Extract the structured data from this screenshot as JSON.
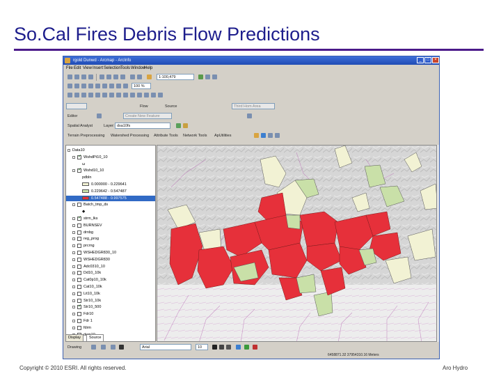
{
  "slide": {
    "title": "So.Cal Fires Debris Flow Predictions",
    "footer_left": "Copyright © 2010 ESRI. All rights reserved.",
    "footer_right": "Aro Hydro"
  },
  "window": {
    "title": "rgold Dunwd - Arcmap - ArcInfo",
    "menu": [
      "File",
      "Edit",
      "View",
      "Insert",
      "Selection",
      "Tools",
      "Window",
      "Help"
    ],
    "controls": [
      "_",
      "□",
      "×"
    ]
  },
  "toolbar": {
    "scale": "1:100,479",
    "zoom": "100 %",
    "flow": "Flow",
    "source": "Source",
    "target_label": "Third Hom Area",
    "editor": "Editor",
    "create_new_feature": "Create New Feature",
    "spatial_analyst": "Spatial Analyst",
    "layer_label": "Layer:",
    "layer_value": "dsa10fs",
    "menu_row": [
      "Terrain Preprocessing",
      "Watershed Processing",
      "Attribute Tools",
      "Network Tools",
      "ApUtilities"
    ],
    "font_name": "Arial",
    "font_size": "10",
    "drawing": "Drawing"
  },
  "toc": {
    "root": "Data10",
    "rows": [
      {
        "label": "Data10",
        "pm": true,
        "cb": "none",
        "indent": 0
      },
      {
        "label": "WshdPt10_10",
        "pm": true,
        "cb": "on",
        "indent": 1
      },
      {
        "label": "ω",
        "pm": false,
        "cb": "none",
        "indent": 2
      },
      {
        "label": "Wshd10_10",
        "pm": true,
        "cb": "on",
        "indent": 1
      },
      {
        "label": "pdbln",
        "pm": false,
        "cb": "none",
        "indent": 2
      },
      {
        "label": "0.000000 - 0.229641",
        "pm": false,
        "cb": "none",
        "indent": 2,
        "swatch": "#f2f2d4"
      },
      {
        "label": "0.229642 - 0.547487",
        "pm": false,
        "cb": "none",
        "indent": 2,
        "swatch": "#c9e0a8"
      },
      {
        "label": "0.547488 - 0.997575",
        "pm": false,
        "cb": "none",
        "indent": 2,
        "swatch": "#e6303a",
        "selected": true
      },
      {
        "label": "Batch_tmp_ds",
        "pm": true,
        "cb": "off",
        "indent": 1
      },
      {
        "label": "◆",
        "pm": false,
        "cb": "none",
        "indent": 2
      },
      {
        "label": "strm_lks",
        "pm": true,
        "cb": "on",
        "indent": 1
      },
      {
        "label": "BURNSEV",
        "pm": true,
        "cb": "off",
        "indent": 1
      },
      {
        "label": "drnbg",
        "pm": true,
        "cb": "off",
        "indent": 1
      },
      {
        "label": "reg_prog",
        "pm": true,
        "cb": "off",
        "indent": 1
      },
      {
        "label": "prcrng",
        "pm": true,
        "cb": "off",
        "indent": 1
      },
      {
        "label": "WSHEDGR830_10",
        "pm": true,
        "cb": "off",
        "indent": 1
      },
      {
        "label": "WSHEDGR830",
        "pm": true,
        "cb": "off",
        "indent": 1
      },
      {
        "label": "Adc0310_10",
        "pm": true,
        "cb": "off",
        "indent": 1
      },
      {
        "label": "Dd10_10k",
        "pm": true,
        "cb": "off",
        "indent": 1
      },
      {
        "label": "Cat0p10_10k",
        "pm": true,
        "cb": "off",
        "indent": 1
      },
      {
        "label": "Cat10_10k",
        "pm": true,
        "cb": "off",
        "indent": 1
      },
      {
        "label": "Lit10_10k",
        "pm": true,
        "cb": "off",
        "indent": 1
      },
      {
        "label": "Str10_10k",
        "pm": true,
        "cb": "off",
        "indent": 1
      },
      {
        "label": "Str10_500",
        "pm": true,
        "cb": "on",
        "indent": 1
      },
      {
        "label": "Fdr10",
        "pm": true,
        "cb": "off",
        "indent": 1
      },
      {
        "label": "Fdr 1",
        "pm": true,
        "cb": "off",
        "indent": 1
      },
      {
        "label": "fdrm",
        "pm": true,
        "cb": "off",
        "indent": 1
      },
      {
        "label": "dem10",
        "pm": true,
        "cb": "off",
        "indent": 1
      }
    ],
    "tabs": [
      "Display",
      "Source"
    ]
  },
  "map": {
    "legend_colors": {
      "low": "#f2f2d4",
      "mid": "#c9e0a8",
      "high": "#e6303a",
      "hillshade": "#d6d6d6",
      "streams": "#b96bb5"
    }
  },
  "status": {
    "coords": "6458871.32  37954310.16 Meters"
  }
}
